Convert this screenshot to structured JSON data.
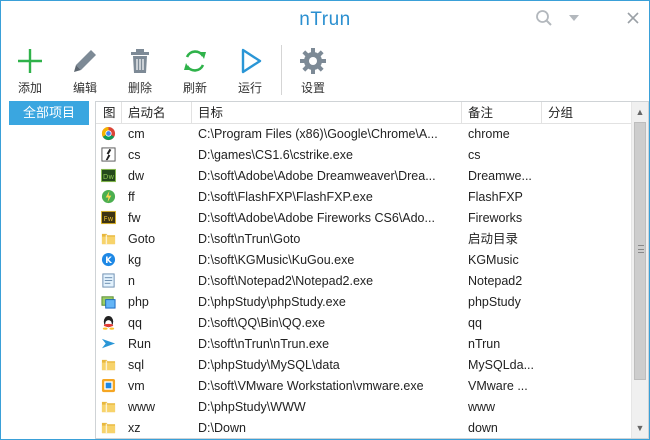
{
  "app": {
    "title": "nTrun"
  },
  "window_controls": {
    "search": "search-icon",
    "menu": "dropdown-icon",
    "close": "close-icon"
  },
  "toolbar": {
    "add": "添加",
    "edit": "编辑",
    "delete": "删除",
    "refresh": "刷新",
    "run": "运行",
    "settings": "设置"
  },
  "colors": {
    "accent": "#3aa6e0",
    "title": "#2a8fd0",
    "add_green": "#2fb24a"
  },
  "sidebar": {
    "items": [
      {
        "label": "全部项目",
        "selected": true
      }
    ]
  },
  "list": {
    "columns": [
      "图",
      "启动名",
      "目标",
      "备注",
      "分组"
    ],
    "rows": [
      {
        "icon": "chrome-icon",
        "name": "cm",
        "target": "C:\\Program Files (x86)\\Google\\Chrome\\A...",
        "note": "chrome",
        "group": ""
      },
      {
        "icon": "cs-icon",
        "name": "cs",
        "target": "D:\\games\\CS1.6\\cstrike.exe",
        "note": "cs",
        "group": ""
      },
      {
        "icon": "dreamweaver-icon",
        "name": "dw",
        "target": "D:\\soft\\Adobe\\Adobe Dreamweaver\\Drea...",
        "note": "Dreamwe...",
        "group": ""
      },
      {
        "icon": "flashfxp-icon",
        "name": "ff",
        "target": "D:\\soft\\FlashFXP\\FlashFXP.exe",
        "note": "FlashFXP",
        "group": ""
      },
      {
        "icon": "fireworks-icon",
        "name": "fw",
        "target": "D:\\soft\\Adobe\\Adobe Fireworks CS6\\Ado...",
        "note": "Fireworks",
        "group": ""
      },
      {
        "icon": "folder-icon",
        "name": "Goto",
        "target": "D:\\soft\\nTrun\\Goto",
        "note": "启动目录",
        "group": ""
      },
      {
        "icon": "kugou-icon",
        "name": "kg",
        "target": "D:\\soft\\KGMusic\\KuGou.exe",
        "note": "KGMusic",
        "group": ""
      },
      {
        "icon": "notepad-icon",
        "name": "n",
        "target": "D:\\soft\\Notepad2\\Notepad2.exe",
        "note": "Notepad2",
        "group": ""
      },
      {
        "icon": "phpstudy-icon",
        "name": "php",
        "target": "D:\\phpStudy\\phpStudy.exe",
        "note": "phpStudy",
        "group": ""
      },
      {
        "icon": "qq-icon",
        "name": "qq",
        "target": "D:\\soft\\QQ\\Bin\\QQ.exe",
        "note": "qq",
        "group": ""
      },
      {
        "icon": "ntrun-icon",
        "name": "Run",
        "target": "D:\\soft\\nTrun\\nTrun.exe",
        "note": "nTrun",
        "group": ""
      },
      {
        "icon": "folder-icon",
        "name": "sql",
        "target": "D:\\phpStudy\\MySQL\\data",
        "note": "MySQLda...",
        "group": ""
      },
      {
        "icon": "vmware-icon",
        "name": "vm",
        "target": "D:\\soft\\VMware Workstation\\vmware.exe",
        "note": "VMware ...",
        "group": ""
      },
      {
        "icon": "folder-icon",
        "name": "www",
        "target": "D:\\phpStudy\\WWW",
        "note": "www",
        "group": ""
      },
      {
        "icon": "folder-icon",
        "name": "xz",
        "target": "D:\\Down",
        "note": "down",
        "group": ""
      }
    ]
  }
}
